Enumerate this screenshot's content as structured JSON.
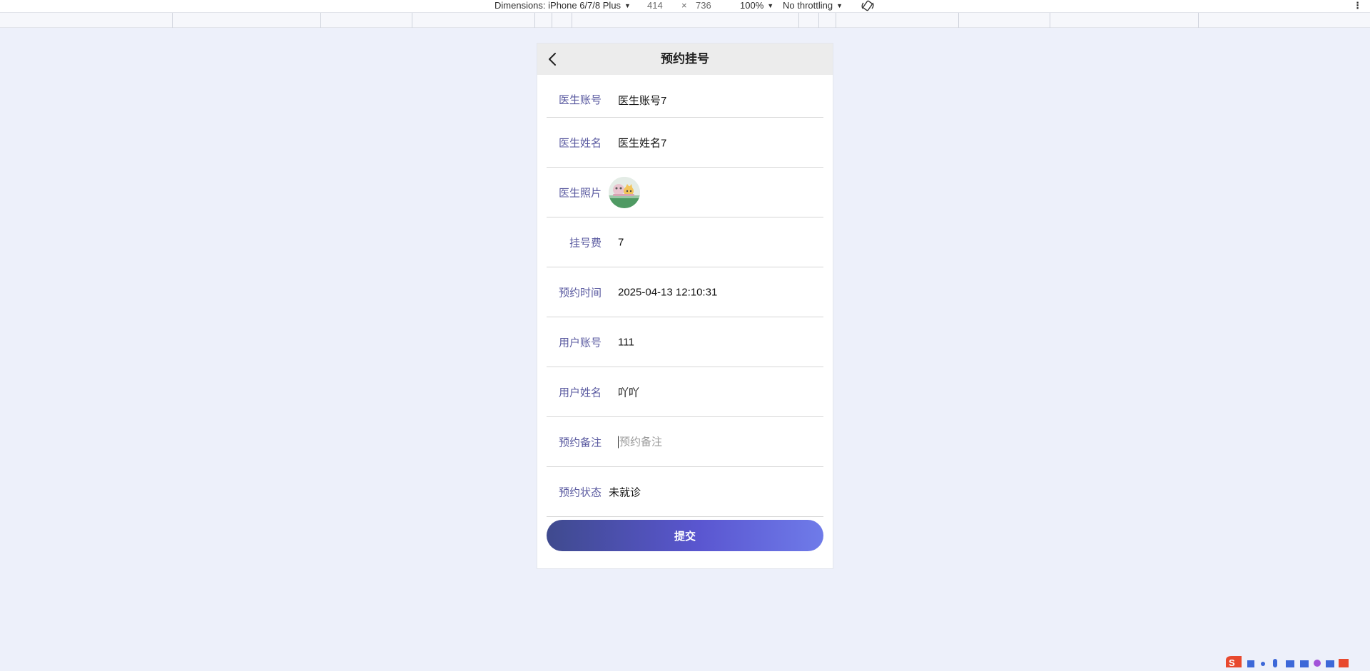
{
  "devtools": {
    "dimensions_label": "Dimensions: iPhone 6/7/8 Plus",
    "width": "414",
    "times": "×",
    "height": "736",
    "zoom": "100%",
    "throttling": "No throttling",
    "more": "⋮"
  },
  "header": {
    "title": "预约挂号"
  },
  "form": {
    "doctor_account": {
      "label": "医生账号",
      "value": "医生账号7"
    },
    "doctor_name": {
      "label": "医生姓名",
      "value": "医生姓名7"
    },
    "doctor_photo": {
      "label": "医生照片"
    },
    "fee": {
      "label": "挂号费",
      "value": "7"
    },
    "appointment_time": {
      "label": "预约时间",
      "value": "2025-04-13 12:10:31"
    },
    "user_account": {
      "label": "用户账号",
      "value": "111"
    },
    "user_name": {
      "label": "用户姓名",
      "value": "吖吖"
    },
    "remark": {
      "label": "预约备注",
      "value": "",
      "placeholder": "预约备注"
    },
    "status": {
      "label": "预约状态",
      "value": "未就诊"
    }
  },
  "submit_label": "提交",
  "colors": {
    "background": "#edf0fa",
    "label": "#5a5aa0",
    "button_start": "#3f4a8e",
    "button_end": "#6f7be9"
  }
}
